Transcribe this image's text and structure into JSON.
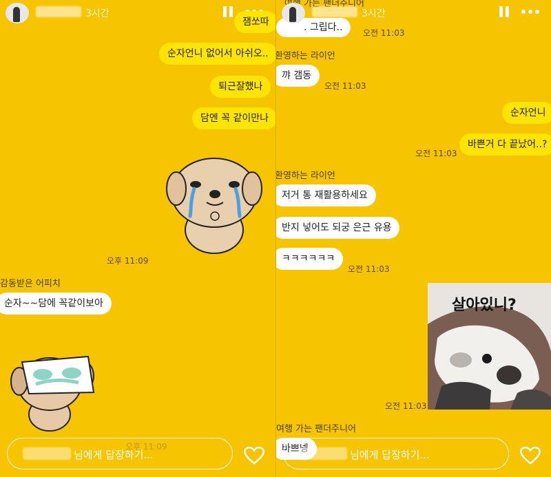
{
  "left": {
    "header": {
      "time_ago": "3시간"
    },
    "messages": {
      "m1": "잼쏘따",
      "m2": "순자언니 없어서 아쉬오..",
      "m3": "퇴근잘했나",
      "m4": "담엔 꼭 같이만나"
    },
    "time_1": "오후 11:09",
    "sender_1": "감동받은 어피치",
    "message_1": "순자~~담에 꼭같이보아",
    "time_2": "오후 11:09",
    "reply_text": "님에게 답장하기..."
  },
  "right": {
    "header": {
      "time_ago": "3시간"
    },
    "sender_top": "여행 가는 팬더주니어",
    "msg_top": ". 그립다..",
    "time_top": "오전 11:03",
    "sender_1": "환영하는 라이언",
    "msg_1": "꺄 갬동",
    "time_1": "오전 11:03",
    "mine_1": "순자언니",
    "mine_2": "바쁜거 다 끝났어..?",
    "time_2": "오전 11:03",
    "sender_2": "환영하는 라이언",
    "msg_2": "저거 통 재활용하세요",
    "msg_3": "반지 넣어도 되궁 은근 유용",
    "msg_4": "ㅋㅋㅋㅋㅋㅋ",
    "time_3": "오전 11:03",
    "photo_caption": "살아있니?",
    "time_4": "오전 11:03",
    "sender_3": "여행 가는 팬더주니어",
    "msg_5": "바쁘넹",
    "reply_text": "님에게 답장하기..."
  },
  "icons": {
    "pause": "pause-icon",
    "more": "more-icon",
    "heart": "heart-icon"
  },
  "colors": {
    "background": "#f6c400",
    "mine_bubble": "#ffe400",
    "their_bubble": "#ffffff"
  }
}
